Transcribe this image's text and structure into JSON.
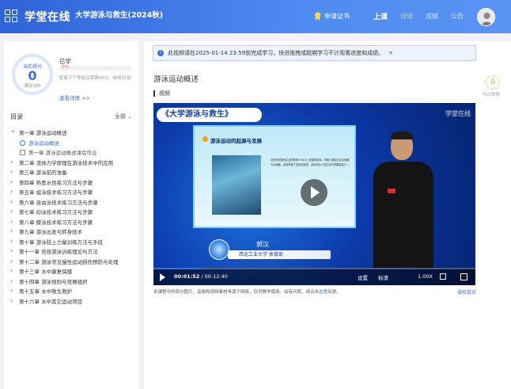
{
  "header": {
    "logo_text": "学堂在线",
    "course_name": "大学游泳与救生(2024秋)",
    "apply_cert": "申请证书",
    "nav": [
      "上课",
      "讨论",
      "成绩",
      "公告"
    ]
  },
  "sidebar": {
    "score_label": "当前得分",
    "score_value": "0",
    "score_full": "满分100",
    "learned_label": "已学",
    "progress_pct": "0%",
    "progress_fraction": 0.0,
    "hint": "距离下个等级还需要60分，继续加油！",
    "detail_link": "查看详情 >>",
    "toc_title": "目录",
    "toc_filter": "全部 ⌄",
    "toc": [
      {
        "label": "第一章 游泳运动概述",
        "type": "chapter",
        "open": true
      },
      {
        "label": "游泳运动概述",
        "type": "sub",
        "current": true
      },
      {
        "label": "第一章 游泳运动概述课后作业",
        "type": "sub-doc"
      },
      {
        "label": "第二章 流体力学原理在游泳技术中的应用",
        "type": "chapter"
      },
      {
        "label": "第三章 游泳前的准备",
        "type": "chapter"
      },
      {
        "label": "第四章 熟悉水性练习方法与步骤",
        "type": "chapter"
      },
      {
        "label": "第五章 蛙泳技术练习方法与步骤",
        "type": "chapter"
      },
      {
        "label": "第六章 自由泳技术练习方法与步骤",
        "type": "chapter"
      },
      {
        "label": "第七章 仰泳技术练习方法与步骤",
        "type": "chapter"
      },
      {
        "label": "第八章 蝶泳技术练习方法与步骤",
        "type": "chapter"
      },
      {
        "label": "第九章 游泳出发与转身技术",
        "type": "chapter"
      },
      {
        "label": "第十章 游泳陆上力量训练方法与手段",
        "type": "chapter"
      },
      {
        "label": "第十一章 竞技游泳训练理论与方法",
        "type": "chapter"
      },
      {
        "label": "第十二章 游泳常见慢性运动损伤预防与处理",
        "type": "chapter"
      },
      {
        "label": "第十三章 水中康复保健",
        "type": "chapter"
      },
      {
        "label": "第十四章 游泳规则与竞赛组织",
        "type": "chapter"
      },
      {
        "label": "第十五章 水中救生救护",
        "type": "chapter"
      },
      {
        "label": "第十六章 水中其它运动项目",
        "type": "chapter"
      }
    ]
  },
  "main": {
    "notice": "此视频请在2025-01-14 23:59前完成学习，快进拖拽或超期学习不计观看进度和成绩。",
    "page_title": "游泳运动概述",
    "today_score": "0",
    "today_label": "今日获得",
    "section_label": "视频",
    "video": {
      "banner": "《大学游泳与救生》",
      "watermark": "学堂在线",
      "slide_title": "游泳运动的起源与发展",
      "slide_text": "自然界和陆地生活的物种70%以上是能够游泳，早期人类因为生存需要与水接触，逐渐掌握了游泳的技能，游泳成为人类生存的重要技能之一。",
      "presenter": "郭汉",
      "affiliation": "西北工业大学 体育部",
      "time_current": "00:01:52",
      "time_total": "00:12:40",
      "played_fraction": 0.147,
      "settings": "设置",
      "quality": "标清",
      "speed": "1.00X"
    },
    "disclaimer": "本课程中的部分图片、音频和视频素材来源于网络，仅供教学使用。如有问题，请点击",
    "disclaimer_link": "这里",
    "disclaimer_end": "反馈。",
    "report": "侵权投诉"
  }
}
